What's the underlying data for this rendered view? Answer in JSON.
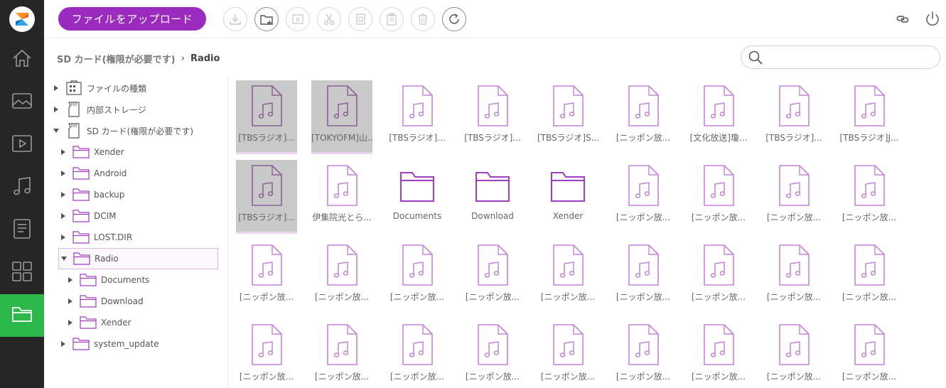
{
  "toolbar": {
    "upload_label": "ファイルをアップロード",
    "buttons": [
      {
        "icon": "download-icon",
        "enabled": false
      },
      {
        "icon": "new-folder-icon",
        "enabled": true
      },
      {
        "icon": "rename-icon",
        "enabled": false
      },
      {
        "icon": "cut-icon",
        "enabled": false
      },
      {
        "icon": "copy-icon",
        "enabled": false
      },
      {
        "icon": "paste-icon",
        "enabled": false
      },
      {
        "icon": "delete-icon",
        "enabled": false
      },
      {
        "icon": "refresh-icon",
        "enabled": true
      }
    ],
    "right_icons": [
      "link-icon",
      "power-icon"
    ]
  },
  "breadcrumb": {
    "parent": "SD カード(権限が必要です)",
    "current": "Radio"
  },
  "search": {
    "placeholder": "",
    "value": ""
  },
  "sidebar": {
    "items": [
      {
        "icon": "home-icon",
        "active": false
      },
      {
        "icon": "image-icon",
        "active": false
      },
      {
        "icon": "video-icon",
        "active": false
      },
      {
        "icon": "music-icon",
        "active": false
      },
      {
        "icon": "document-icon",
        "active": false
      },
      {
        "icon": "apps-icon",
        "active": false
      },
      {
        "icon": "folder-icon",
        "active": true
      }
    ],
    "accent_color": "#2db84b"
  },
  "tree": [
    {
      "label": "ファイルの種類",
      "icon": "file-types-icon",
      "expanded": false,
      "level": 0
    },
    {
      "label": "内部ストレージ",
      "icon": "sd-card-icon",
      "expanded": false,
      "level": 0
    },
    {
      "label": "SD カード(権限が必要です)",
      "icon": "sd-card-icon",
      "expanded": true,
      "level": 0
    },
    {
      "label": "Xender",
      "icon": "folder-icon",
      "expanded": false,
      "level": 1
    },
    {
      "label": "Android",
      "icon": "folder-icon",
      "expanded": false,
      "level": 1
    },
    {
      "label": "backup",
      "icon": "folder-icon",
      "expanded": false,
      "level": 1
    },
    {
      "label": "DCIM",
      "icon": "folder-icon",
      "expanded": false,
      "level": 1
    },
    {
      "label": "LOST.DIR",
      "icon": "folder-icon",
      "expanded": false,
      "level": 1
    },
    {
      "label": "Radio",
      "icon": "folder-icon",
      "expanded": true,
      "level": 1,
      "selected": true
    },
    {
      "label": "Documents",
      "icon": "folder-icon",
      "expanded": false,
      "level": 2
    },
    {
      "label": "Download",
      "icon": "folder-icon",
      "expanded": false,
      "level": 2
    },
    {
      "label": "Xender",
      "icon": "folder-icon",
      "expanded": false,
      "level": 2
    },
    {
      "label": "system_update",
      "icon": "folder-icon",
      "expanded": false,
      "level": 1
    }
  ],
  "files": [
    {
      "name": "[TBSラジオ]...",
      "type": "audio",
      "selected": true
    },
    {
      "name": "[TOKYOFM]山...",
      "type": "audio",
      "selected": true
    },
    {
      "name": "[TBSラジオ]...",
      "type": "audio",
      "selected": false
    },
    {
      "name": "[TBSラジオ]...",
      "type": "audio",
      "selected": false
    },
    {
      "name": "[TBSラジオ]S...",
      "type": "audio",
      "selected": false
    },
    {
      "name": "[ニッポン放...",
      "type": "audio",
      "selected": false
    },
    {
      "name": "[文化放送]瓊...",
      "type": "audio",
      "selected": false
    },
    {
      "name": "[TBSラジオ]...",
      "type": "audio",
      "selected": false
    },
    {
      "name": "[TBSラジオ]J...",
      "type": "audio",
      "selected": false
    },
    {
      "name": "[TBSラジオ]...",
      "type": "audio",
      "selected": true
    },
    {
      "name": "伊集院光とら...",
      "type": "audio",
      "selected": false
    },
    {
      "name": "Documents",
      "type": "folder",
      "selected": false
    },
    {
      "name": "Download",
      "type": "folder",
      "selected": false
    },
    {
      "name": "Xender",
      "type": "folder",
      "selected": false
    },
    {
      "name": "[ニッポン放...",
      "type": "audio",
      "selected": false
    },
    {
      "name": "[ニッポン放...",
      "type": "audio",
      "selected": false
    },
    {
      "name": "[ニッポン放...",
      "type": "audio",
      "selected": false
    },
    {
      "name": "[ニッポン放...",
      "type": "audio",
      "selected": false
    },
    {
      "name": "[ニッポン放...",
      "type": "audio",
      "selected": false
    },
    {
      "name": "[ニッポン放...",
      "type": "audio",
      "selected": false
    },
    {
      "name": "[ニッポン放...",
      "type": "audio",
      "selected": false
    },
    {
      "name": "[ニッポン放...",
      "type": "audio",
      "selected": false
    },
    {
      "name": "[ニッポン放...",
      "type": "audio",
      "selected": false
    },
    {
      "name": "[ニッポン放...",
      "type": "audio",
      "selected": false
    },
    {
      "name": "[ニッポン放...",
      "type": "audio",
      "selected": false
    },
    {
      "name": "[ニッポン放...",
      "type": "audio",
      "selected": false
    },
    {
      "name": "[ニッポン放...",
      "type": "audio",
      "selected": false
    },
    {
      "name": "[ニッポン放...",
      "type": "audio",
      "selected": false
    },
    {
      "name": "[ニッポン放...",
      "type": "audio",
      "selected": false
    },
    {
      "name": "[ニッポン放...",
      "type": "audio",
      "selected": false
    },
    {
      "name": "[ニッポン放...",
      "type": "audio",
      "selected": false
    },
    {
      "name": "[ニッポン放...",
      "type": "audio",
      "selected": false
    },
    {
      "name": "[ニッポン放...",
      "type": "audio",
      "selected": false
    },
    {
      "name": "[ニッポン放...",
      "type": "audio",
      "selected": false
    },
    {
      "name": "[ニッポン放...",
      "type": "audio",
      "selected": false
    },
    {
      "name": "[ニッポン放...",
      "type": "audio",
      "selected": false
    }
  ],
  "colors": {
    "accent_purple": "#9b2bbf",
    "icon_purple": "#c983dd",
    "selected_icon": "#8a5f98"
  }
}
